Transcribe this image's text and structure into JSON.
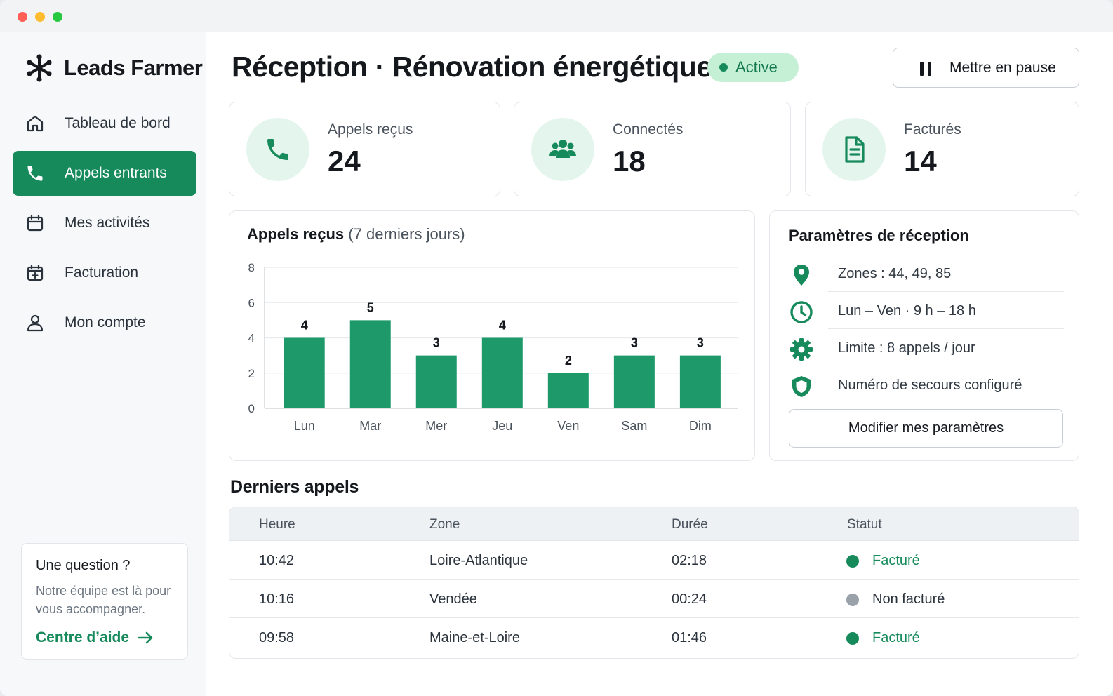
{
  "app": {
    "name": "Leads Farmer"
  },
  "sidebar": {
    "items": [
      {
        "label": "Tableau de bord",
        "icon": "home-icon",
        "active": false
      },
      {
        "label": "Appels entrants",
        "icon": "phone-icon",
        "active": true
      },
      {
        "label": "Mes activités",
        "icon": "calendar-icon",
        "active": false
      },
      {
        "label": "Facturation",
        "icon": "calendar-plus-icon",
        "active": false
      },
      {
        "label": "Mon compte",
        "icon": "user-icon",
        "active": false
      }
    ],
    "help": {
      "title": "Une question ?",
      "text": "Notre équipe est là pour vous accompagner.",
      "link_label": "Centre d’aide"
    }
  },
  "header": {
    "title": "Réception · Rénovation énergétique",
    "status": "Active",
    "pause_label": "Mettre en pause"
  },
  "stats": [
    {
      "label": "Appels reçus",
      "value": "24",
      "icon": "phone-icon"
    },
    {
      "label": "Connectés",
      "value": "18",
      "icon": "users-icon"
    },
    {
      "label": "Facturés",
      "value": "14",
      "icon": "document-icon"
    }
  ],
  "chart": {
    "title": "Appels reçus",
    "subtitle": "(7 derniers jours)"
  },
  "chart_data": {
    "type": "bar",
    "title": "Appels reçus (7 derniers jours)",
    "categories": [
      "Lun",
      "Mar",
      "Mer",
      "Jeu",
      "Ven",
      "Sam",
      "Dim"
    ],
    "values": [
      4,
      5,
      3,
      4,
      2,
      3,
      3
    ],
    "ylim": [
      0,
      8
    ],
    "yticks": [
      0,
      2,
      4,
      6,
      8
    ],
    "xlabel": "",
    "ylabel": "",
    "grid": true,
    "color": "#1e9a6a",
    "data_labels": true
  },
  "settings": {
    "title": "Paramètres de réception",
    "rows": [
      {
        "text": "Zones : 44, 49, 85",
        "icon": "map-pin-icon"
      },
      {
        "text": "Lun – Ven · 9 h – 18 h",
        "icon": "clock-icon"
      },
      {
        "text": "Limite : 8 appels / jour",
        "icon": "gear-icon"
      },
      {
        "text": "Numéro de secours configuré",
        "icon": "shield-icon"
      }
    ],
    "button_label": "Modifier mes paramètres"
  },
  "calls": {
    "title": "Derniers appels",
    "headers": [
      "Heure",
      "Zone",
      "Durée",
      "Statut"
    ],
    "rows": [
      {
        "time": "10:42",
        "zone": "Loire-Atlantique",
        "duration": "02:18",
        "status": "Facturé",
        "billed": true
      },
      {
        "time": "10:16",
        "zone": "Vendée",
        "duration": "00:24",
        "status": "Non facturé",
        "billed": false
      },
      {
        "time": "09:58",
        "zone": "Maine-et-Loire",
        "duration": "01:46",
        "status": "Facturé",
        "billed": true
      }
    ]
  },
  "colors": {
    "accent": "#178a5c",
    "bar": "#1e9a6a",
    "billed": "#178a5c",
    "not_billed": "#9aa1a9"
  }
}
